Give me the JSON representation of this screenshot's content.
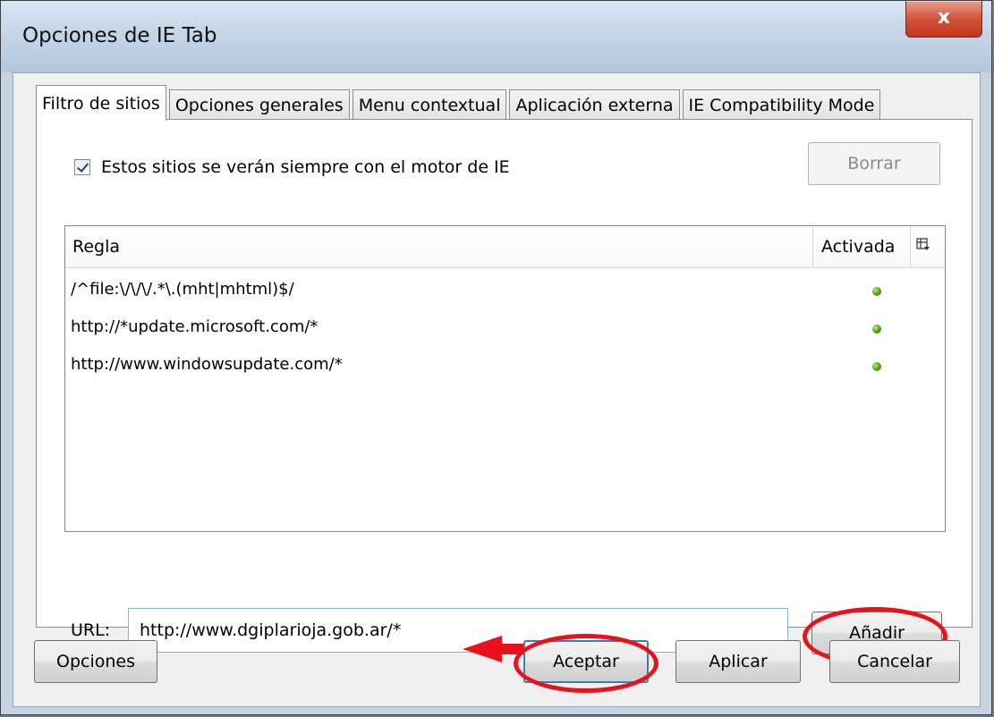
{
  "window": {
    "title": "Opciones de IE Tab",
    "close_glyph": "x"
  },
  "tabs": [
    {
      "label": "Filtro de sitios",
      "active": true
    },
    {
      "label": "Opciones generales",
      "active": false
    },
    {
      "label": "Menu contextual",
      "active": false
    },
    {
      "label": "Aplicación externa",
      "active": false
    },
    {
      "label": "IE Compatibility Mode",
      "active": false
    }
  ],
  "filter": {
    "checkbox_label": "Estos sitios se verán siempre con el motor de IE",
    "checkbox_checked": true,
    "clear_button": "Borrar",
    "list": {
      "columns": [
        "Regla",
        "Activada"
      ],
      "column_picker_icon": "column-picker-icon",
      "rows": [
        {
          "rule": "/^file:\\/\\/\\/.*\\.(mht|mhtml)$/",
          "enabled": true
        },
        {
          "rule": "http://*update.microsoft.com/*",
          "enabled": true
        },
        {
          "rule": "http://www.windowsupdate.com/*",
          "enabled": true
        }
      ]
    },
    "url_label": "URL:",
    "url_value": "http://www.dgiplarioja.gob.ar/*",
    "add_button": "Añadir"
  },
  "footer": {
    "options_button": "Opciones",
    "accept_button": "Aceptar",
    "apply_button": "Aplicar",
    "cancel_button": "Cancelar"
  },
  "colors": {
    "annotation": "#e8121c",
    "enabled_dot": "#49a012"
  }
}
